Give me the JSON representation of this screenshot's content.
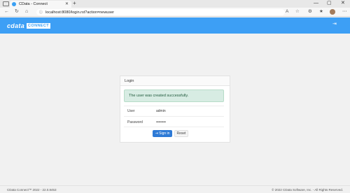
{
  "browser": {
    "tab_title": "CData - Connect",
    "tab_close": "✕",
    "new_tab": "+",
    "url": "localhost:8080/login.rst?action=newuser",
    "window_controls": [
      "—",
      "▢",
      "✕"
    ]
  },
  "header": {
    "logo_text": "cdata",
    "logo_badge": "CONNECT",
    "logout_icon": "⇥"
  },
  "login": {
    "panel_title": "Login",
    "alert": "The user was created successfully.",
    "user_label": "User",
    "user_value": "admin",
    "password_label": "Password",
    "password_value": "••••••••",
    "signin_label": "⇥ Sign in",
    "reset_label": "Reset"
  },
  "footer": {
    "left": "CData Connect™ 2022 - 22.0.8453",
    "right": "© 2022 CData Software, Inc. - All Rights Reserved."
  },
  "colors": {
    "header_bg": "#3d9ff5",
    "signin_bg": "#2e7ad6",
    "alert_bg": "#d7ece3"
  }
}
